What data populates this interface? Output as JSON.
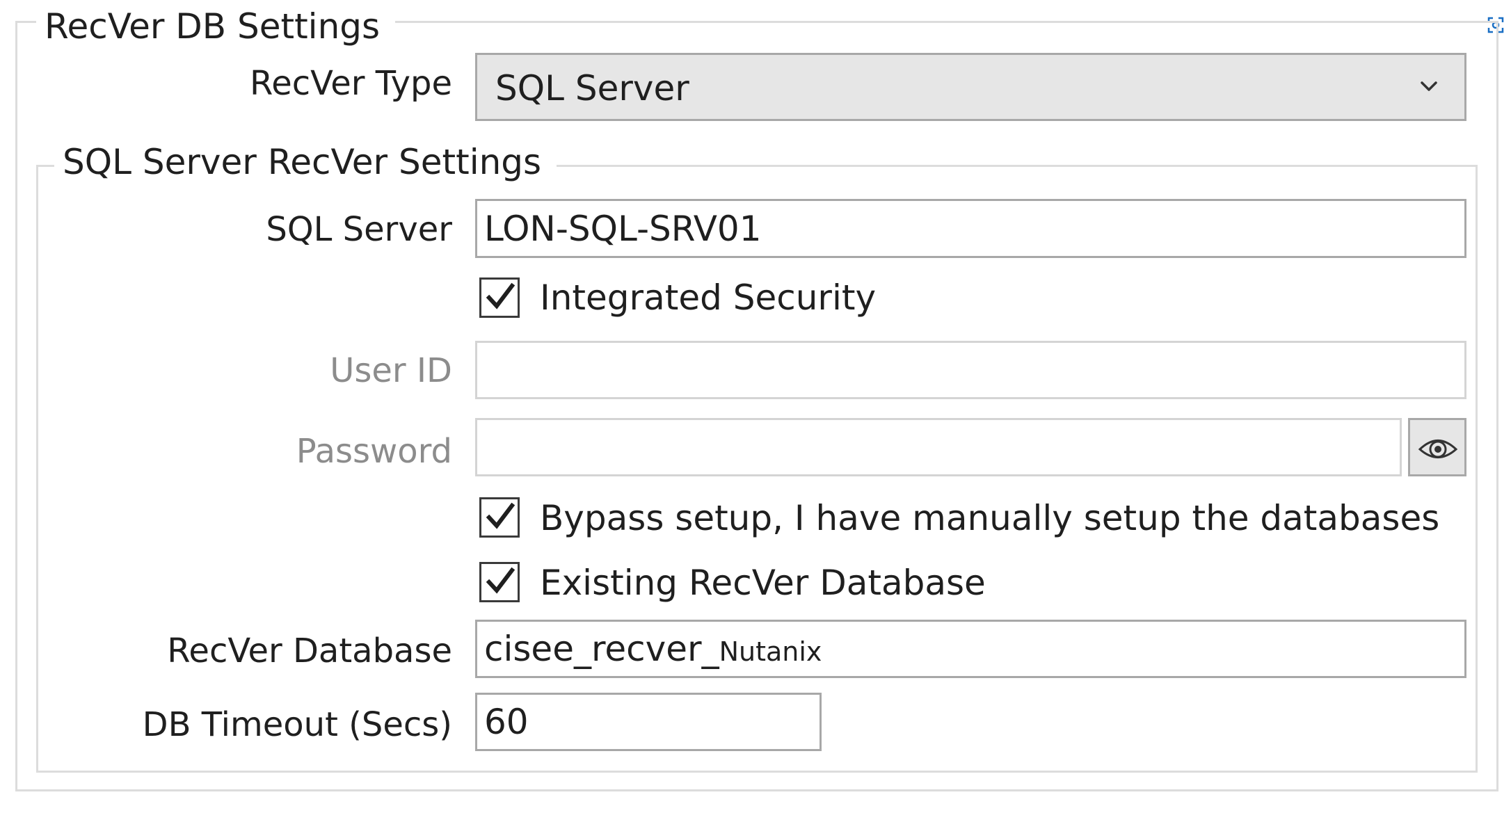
{
  "outer_group": {
    "title": "RecVer DB Settings"
  },
  "recver_type": {
    "label": "RecVer Type",
    "value": "SQL Server",
    "arrow_icon": "chevron-down-icon"
  },
  "inner_group": {
    "title": "SQL Server RecVer Settings"
  },
  "sql_server": {
    "label": "SQL Server",
    "value": "LON-SQL-SRV01"
  },
  "integrated_security": {
    "label": "Integrated Security",
    "checked": true
  },
  "user_id": {
    "label": "User ID",
    "value": "",
    "disabled": true
  },
  "password": {
    "label": "Password",
    "value": "",
    "disabled": true,
    "toggle_icon": "eye-icon"
  },
  "bypass_setup": {
    "label": "Bypass setup, I have manually setup the databases",
    "checked": true
  },
  "existing_db": {
    "label": "Existing RecVer Database",
    "checked": true
  },
  "recver_database": {
    "label": "RecVer Database",
    "value_main": "cisee_recver_",
    "value_suffix": "Nutanix"
  },
  "db_timeout": {
    "label": "DB Timeout (Secs)",
    "value": "60"
  },
  "corner": {
    "icon": "screen-capture-icon"
  },
  "colors": {
    "accent_border": "#a8a8a8",
    "group_border": "#dcdcdc",
    "disabled_text": "#8c8c8c"
  }
}
